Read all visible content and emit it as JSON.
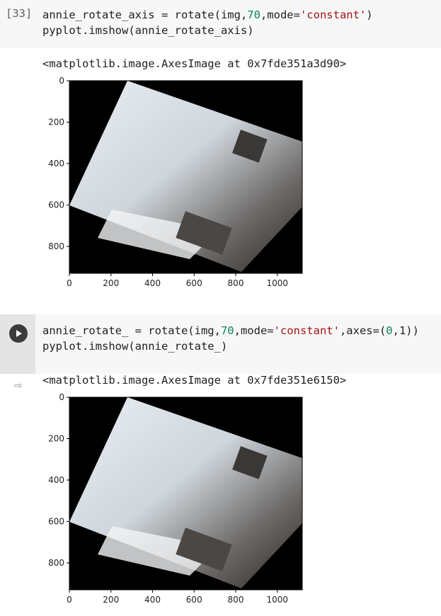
{
  "cells": [
    {
      "prompt": "[33]",
      "code_line1_a": "annie_rotate_axis = rotate(img,",
      "code_line1_num": "70",
      "code_line1_b": ",mode=",
      "code_line1_str": "'constant'",
      "code_line1_c": ")",
      "code_line2": "pyplot.imshow(annie_rotate_axis)",
      "output": "<matplotlib.image.AxesImage at 0x7fde351a3d90>"
    },
    {
      "code_line1_a": "annie_rotate_ = rotate(img,",
      "code_line1_num": "70",
      "code_line1_b": ",mode=",
      "code_line1_str": "'constant'",
      "code_line1_c": ",axes=(",
      "code_line1_num2": "0",
      "code_line1_d": ",1))",
      "code_line2": "pyplot.imshow(annie_rotate_)",
      "output": "<matplotlib.image.AxesImage at 0x7fde351e6150>"
    }
  ],
  "chart_data": [
    {
      "type": "image",
      "xticks": [
        "0",
        "200",
        "400",
        "600",
        "800",
        "1000"
      ],
      "yticks": [
        "0",
        "200",
        "400",
        "600",
        "800"
      ],
      "xlim": [
        0,
        1120
      ],
      "ylim": [
        930,
        0
      ]
    },
    {
      "type": "image",
      "xticks": [
        "0",
        "200",
        "400",
        "600",
        "800",
        "1000"
      ],
      "yticks": [
        "0",
        "200",
        "400",
        "600",
        "800"
      ],
      "xlim": [
        0,
        1120
      ],
      "ylim": [
        930,
        0
      ]
    }
  ]
}
